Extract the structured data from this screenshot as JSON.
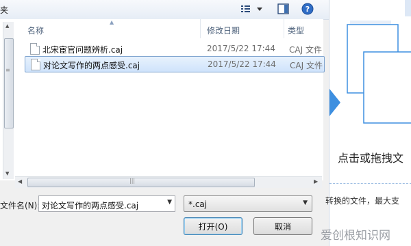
{
  "toolbar": {
    "breadcrumb": "夹",
    "view_icon": "view-options-icon",
    "preview_icon": "preview-pane-icon",
    "help_icon": "help-icon"
  },
  "columns": {
    "name": "名称",
    "date": "修改日期",
    "type": "类型"
  },
  "files": [
    {
      "name": "北宋宦官问题辨析.caj",
      "date": "2017/5/22 17:44",
      "type": "CAJ 文件",
      "selected": false
    },
    {
      "name": "对论文写作的两点感受.caj",
      "date": "2017/5/22 17:44",
      "type": "CAJ 文件",
      "selected": true
    }
  ],
  "filename": {
    "label": "文件名(N):",
    "value": "对论文写作的两点感受.caj"
  },
  "filetype": {
    "value": "*.caj"
  },
  "buttons": {
    "open": "打开(O)",
    "cancel": "取消"
  },
  "right_panel": {
    "prompt": "点击或拖拽文",
    "hint": "转换的文件，最大支"
  },
  "watermark": "爱创根知识网",
  "colors": {
    "accent": "#3d8fe0",
    "selection": "#cfe3fb",
    "illustration": "#dde8f6"
  }
}
